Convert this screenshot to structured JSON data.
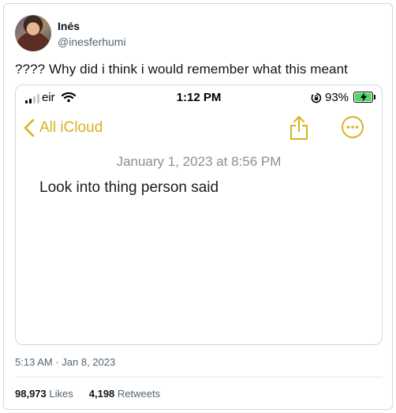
{
  "author": {
    "display_name": "Inés",
    "handle": "@inesferhumi"
  },
  "tweet": {
    "text": "???? Why did i think i would remember what this meant",
    "timestamp": "5:13 AM",
    "date": "Jan 8, 2023",
    "likes_count": "98,973",
    "likes_label": "Likes",
    "retweets_count": "4,198",
    "retweets_label": "Retweets"
  },
  "screenshot": {
    "status_bar": {
      "carrier": "eir",
      "time": "1:12 PM",
      "battery_percent": "93%",
      "battery_level": 0.93
    },
    "nav": {
      "back_label": "All iCloud"
    },
    "note": {
      "date": "January 1, 2023 at 8:56 PM",
      "body": "Look into thing person said"
    },
    "colors": {
      "accent": "#d8b21c",
      "battery_green": "#4cd964"
    }
  }
}
